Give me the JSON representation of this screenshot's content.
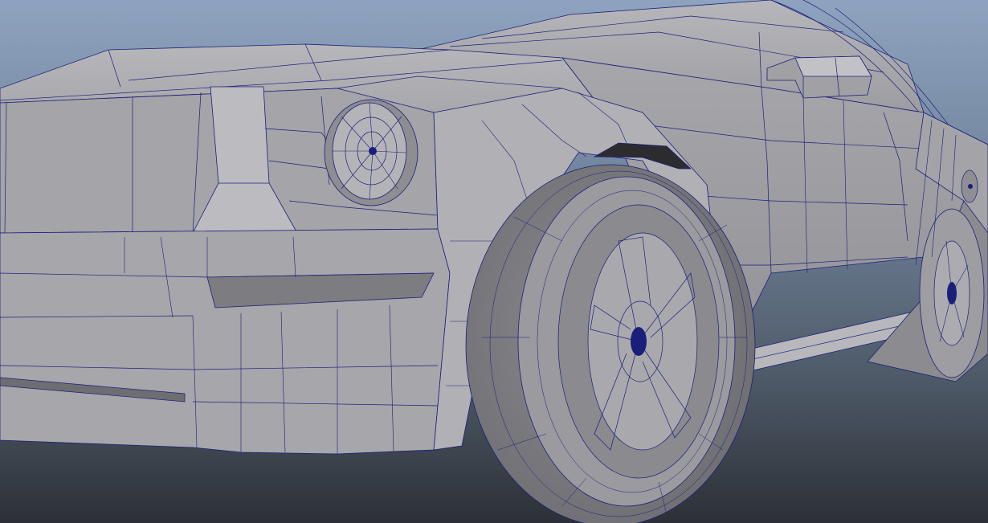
{
  "viewport": {
    "gradient_top": "#8ea3bf",
    "gradient_bottom": "#2c3036",
    "wire_color": "#1a1f7a",
    "body_color": "#a9a9ad",
    "shadow_color": "#6b6b70",
    "highlight_color": "#c6c6c9"
  }
}
